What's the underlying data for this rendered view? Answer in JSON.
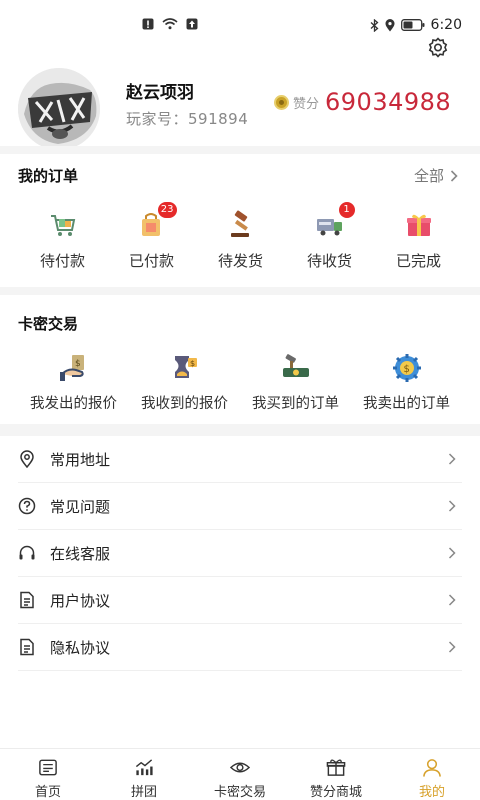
{
  "status_bar": {
    "time": "6:20"
  },
  "profile": {
    "name": "赵云项羽",
    "player_id": "玩家号：591894",
    "points_label": "赞分",
    "points_value": "69034988"
  },
  "orders": {
    "title": "我的订单",
    "view_all": "全部",
    "items": [
      {
        "label": "待付款",
        "icon": "cart-icon"
      },
      {
        "label": "已付款",
        "icon": "paid-bag-icon",
        "badge": "23"
      },
      {
        "label": "待发货",
        "icon": "gavel-icon"
      },
      {
        "label": "待收货",
        "icon": "delivery-truck-icon",
        "badge": "1"
      },
      {
        "label": "已完成",
        "icon": "gift-box-icon"
      }
    ]
  },
  "card_trade": {
    "title": "卡密交易",
    "items": [
      {
        "label": "我发出的报价",
        "icon": "offer-sent-icon"
      },
      {
        "label": "我收到的报价",
        "icon": "offer-received-icon"
      },
      {
        "label": "我买到的订单",
        "icon": "bought-order-icon"
      },
      {
        "label": "我卖出的订单",
        "icon": "sold-order-icon"
      }
    ]
  },
  "menu": [
    {
      "label": "常用地址",
      "icon": "location-pin-icon"
    },
    {
      "label": "常见问题",
      "icon": "question-circle-icon"
    },
    {
      "label": "在线客服",
      "icon": "headset-icon"
    },
    {
      "label": "用户协议",
      "icon": "document-icon"
    },
    {
      "label": "隐私协议",
      "icon": "document-icon"
    }
  ],
  "tabbar": [
    {
      "label": "首页",
      "icon": "home-news-icon"
    },
    {
      "label": "拼团",
      "icon": "bar-trend-icon"
    },
    {
      "label": "卡密交易",
      "icon": "eye-icon"
    },
    {
      "label": "赞分商城",
      "icon": "gift-icon"
    },
    {
      "label": "我的",
      "icon": "user-icon",
      "active": true
    }
  ],
  "colors": {
    "accent": "#d7a12b",
    "points": "#c8283a",
    "badge": "#e52a2a"
  }
}
